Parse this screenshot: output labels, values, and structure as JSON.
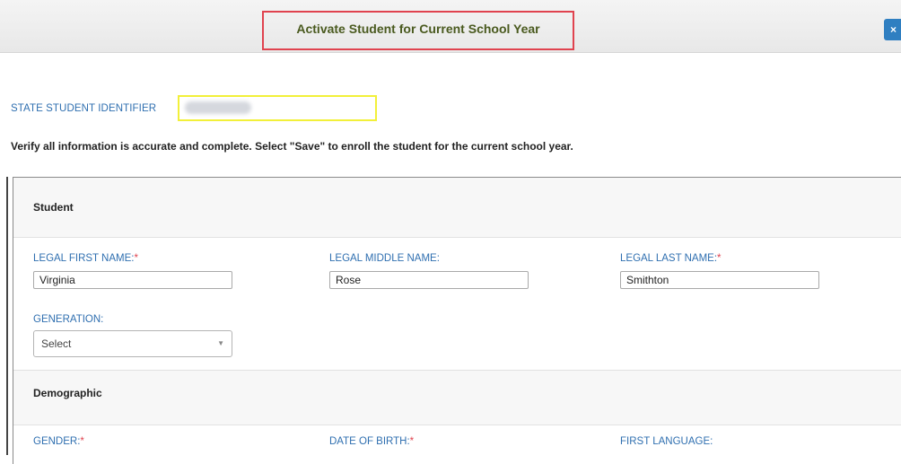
{
  "dialog": {
    "title": "Activate Student for Current School Year",
    "close_icon": "close-icon",
    "close_label": "×"
  },
  "identifier": {
    "label": "STATE STUDENT IDENTIFIER",
    "value": "0047000223"
  },
  "instruction": "Verify all information is accurate and complete. Select \"Save\" to enroll the student for the current school year.",
  "sections": {
    "student": {
      "title": "Student",
      "first_name_label": "LEGAL FIRST NAME:",
      "first_name_value": "Virginia",
      "middle_name_label": "LEGAL MIDDLE NAME:",
      "middle_name_value": "Rose",
      "last_name_label": "LEGAL LAST NAME:",
      "last_name_value": "Smithton",
      "generation_label": "GENERATION:",
      "generation_value": "Select",
      "required_mark": "*"
    },
    "demographic": {
      "title": "Demographic",
      "gender_label": "GENDER:",
      "dob_label": "DATE OF BIRTH:",
      "first_language_label": "FIRST LANGUAGE:",
      "required_mark": "*"
    }
  },
  "colors": {
    "label_blue": "#2f6fb0",
    "required_red": "#e0434f",
    "title_highlight": "#e0434f",
    "identifier_highlight": "#f2f03a",
    "title_text": "#4a5a1f",
    "close_button": "#2f7fc1"
  }
}
